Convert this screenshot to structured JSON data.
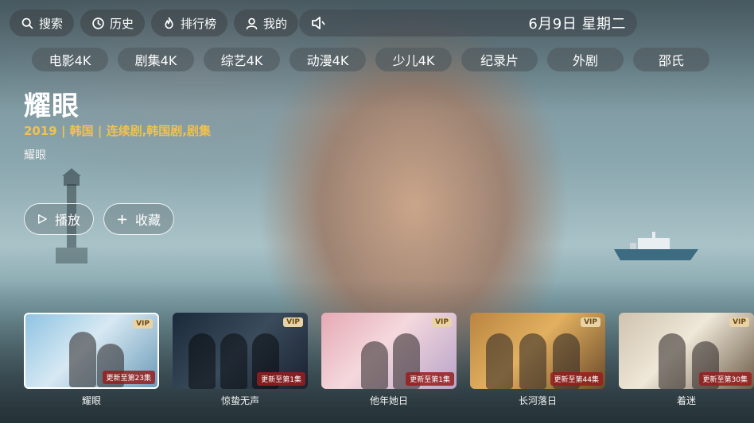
{
  "topbar": {
    "search_label": "搜索",
    "history_label": "历史",
    "ranking_label": "排行榜",
    "mine_label": "我的",
    "date": "6月9日  星期二"
  },
  "categories": [
    "电影4K",
    "剧集4K",
    "综艺4K",
    "动漫4K",
    "少儿4K",
    "纪录片",
    "外剧",
    "邵氏"
  ],
  "featured": {
    "title": "耀眼",
    "meta": "2019 | 韩国 | 连续剧,韩国剧,剧集",
    "subtitle": "耀眼",
    "play_label": "播放",
    "favorite_label": "收藏"
  },
  "recommendations": [
    {
      "title": "耀眼",
      "badge": "更新至第23集",
      "vip": "VIP"
    },
    {
      "title": "惊蛰无声",
      "badge": "更新至第1集",
      "vip": "VIP"
    },
    {
      "title": "他年她日",
      "badge": "更新至第1集",
      "vip": "VIP"
    },
    {
      "title": "长河落日",
      "badge": "更新至第44集",
      "vip": "VIP"
    },
    {
      "title": "着迷",
      "badge": "更新至第30集",
      "vip": "VIP"
    }
  ],
  "colors": {
    "accent_meta": "#f2c14e",
    "badge_bg": "#961e1e",
    "vip_bg": "#e9d3a6"
  }
}
